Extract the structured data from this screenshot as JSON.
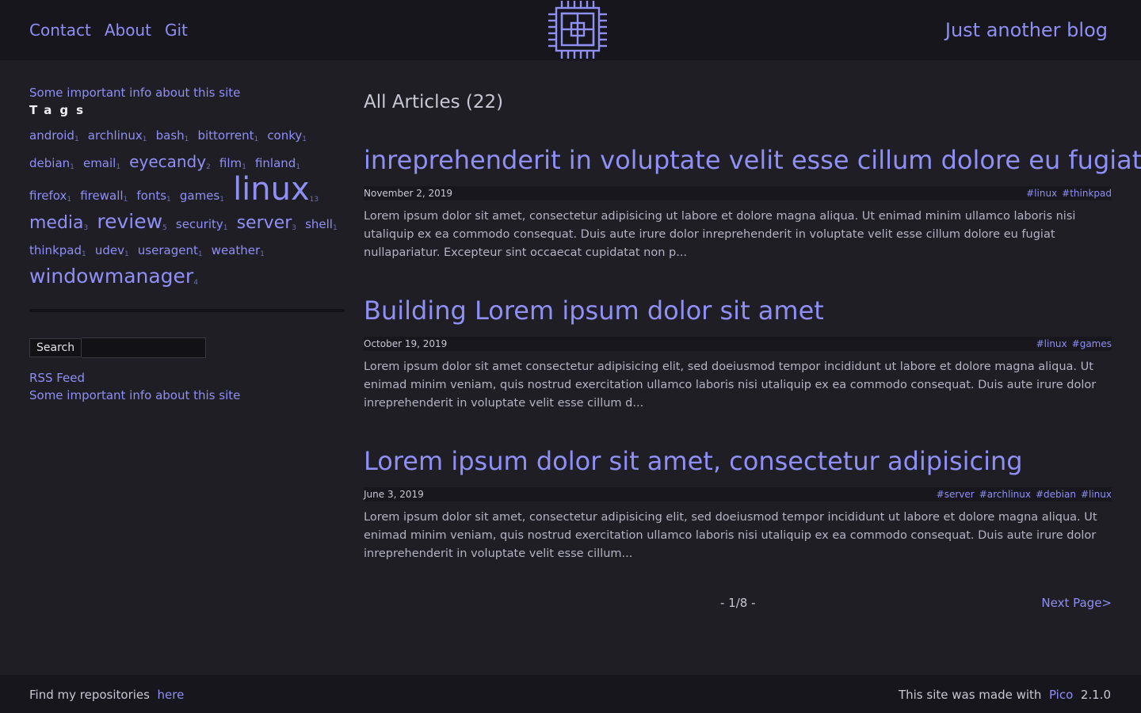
{
  "header": {
    "nav": [
      "Contact",
      "About",
      "Git"
    ],
    "logo_icon": "cpu-chip-icon",
    "site_title": "Just another blog"
  },
  "sidebar": {
    "info_link": "Some important info about this site",
    "tags_heading": "Tags",
    "tags": [
      {
        "name": "android",
        "count": "1"
      },
      {
        "name": "archlinux",
        "count": "1"
      },
      {
        "name": "bash",
        "count": "1"
      },
      {
        "name": "bittorrent",
        "count": "1"
      },
      {
        "name": "conky",
        "count": "1"
      },
      {
        "name": "debian",
        "count": "1"
      },
      {
        "name": "email",
        "count": "1"
      },
      {
        "name": "eyecandy",
        "count": "2"
      },
      {
        "name": "film",
        "count": "1"
      },
      {
        "name": "finland",
        "count": "1"
      },
      {
        "name": "firefox",
        "count": "1"
      },
      {
        "name": "firewall",
        "count": "1"
      },
      {
        "name": "fonts",
        "count": "1"
      },
      {
        "name": "games",
        "count": "1"
      },
      {
        "name": "linux",
        "count": "13"
      },
      {
        "name": "media",
        "count": "3"
      },
      {
        "name": "review",
        "count": "5"
      },
      {
        "name": "security",
        "count": "1"
      },
      {
        "name": "server",
        "count": "3"
      },
      {
        "name": "shell",
        "count": "1"
      },
      {
        "name": "thinkpad",
        "count": "1"
      },
      {
        "name": "udev",
        "count": "1"
      },
      {
        "name": "useragent",
        "count": "1"
      },
      {
        "name": "weather",
        "count": "1"
      },
      {
        "name": "windowmanager",
        "count": "4"
      }
    ],
    "search_button": "Search",
    "search_value": "",
    "rss_link": "RSS Feed",
    "info_link_bottom": "Some important info about this site"
  },
  "main": {
    "heading": "All Articles (22)",
    "articles": [
      {
        "title": "inreprehenderit in voluptate velit esse cillum dolore eu fugiat",
        "date": "November 2, 2019",
        "tags": [
          "#linux",
          "#thinkpad"
        ],
        "excerpt": "Lorem ipsum dolor sit amet, consectetur adipisicing ut labore et dolore magna aliqua. Ut enimad minim ullamco laboris nisi utaliquip ex ea commodo consequat. Duis aute irure dolor inreprehenderit in voluptate velit esse cillum dolore eu fugiat nullapariatur. Excepteur sint occaecat cupidatat non p..."
      },
      {
        "title": "Building Lorem ipsum dolor sit amet",
        "date": "October 19, 2019",
        "tags": [
          "#linux",
          "#games"
        ],
        "excerpt": "Lorem ipsum dolor sit amet consectetur adipisicing elit, sed doeiusmod tempor incididunt ut labore et dolore magna aliqua. Ut enimad minim veniam, quis nostrud exercitation ullamco laboris nisi utaliquip ex ea commodo consequat. Duis aute irure dolor inreprehenderit in voluptate velit esse cillum d..."
      },
      {
        "title": "Lorem ipsum dolor sit amet, consectetur adipisicing",
        "date": "June 3, 2019",
        "tags": [
          "#server",
          "#archlinux",
          "#debian",
          "#linux"
        ],
        "excerpt": "Lorem ipsum dolor sit amet, consectetur adipisicing elit, sed doeiusmod tempor incididunt ut labore et dolore magna aliqua. Ut enimad minim veniam, quis nostrud exercitation ullamco laboris nisi utaliquip ex ea commodo consequat. Duis aute irure dolor inreprehenderit in voluptate velit esse cillum..."
      }
    ],
    "pager": {
      "count": "- 1/8 -",
      "next": "Next Page>"
    }
  },
  "footer": {
    "left_text": "Find my repositories",
    "left_link": "here",
    "right_text": "This site was made with",
    "right_link": "Pico",
    "version": "2.1.0"
  },
  "colors": {
    "accent": "#8f8ff6",
    "background": "#1f1e25",
    "header_bg": "#17161c"
  }
}
